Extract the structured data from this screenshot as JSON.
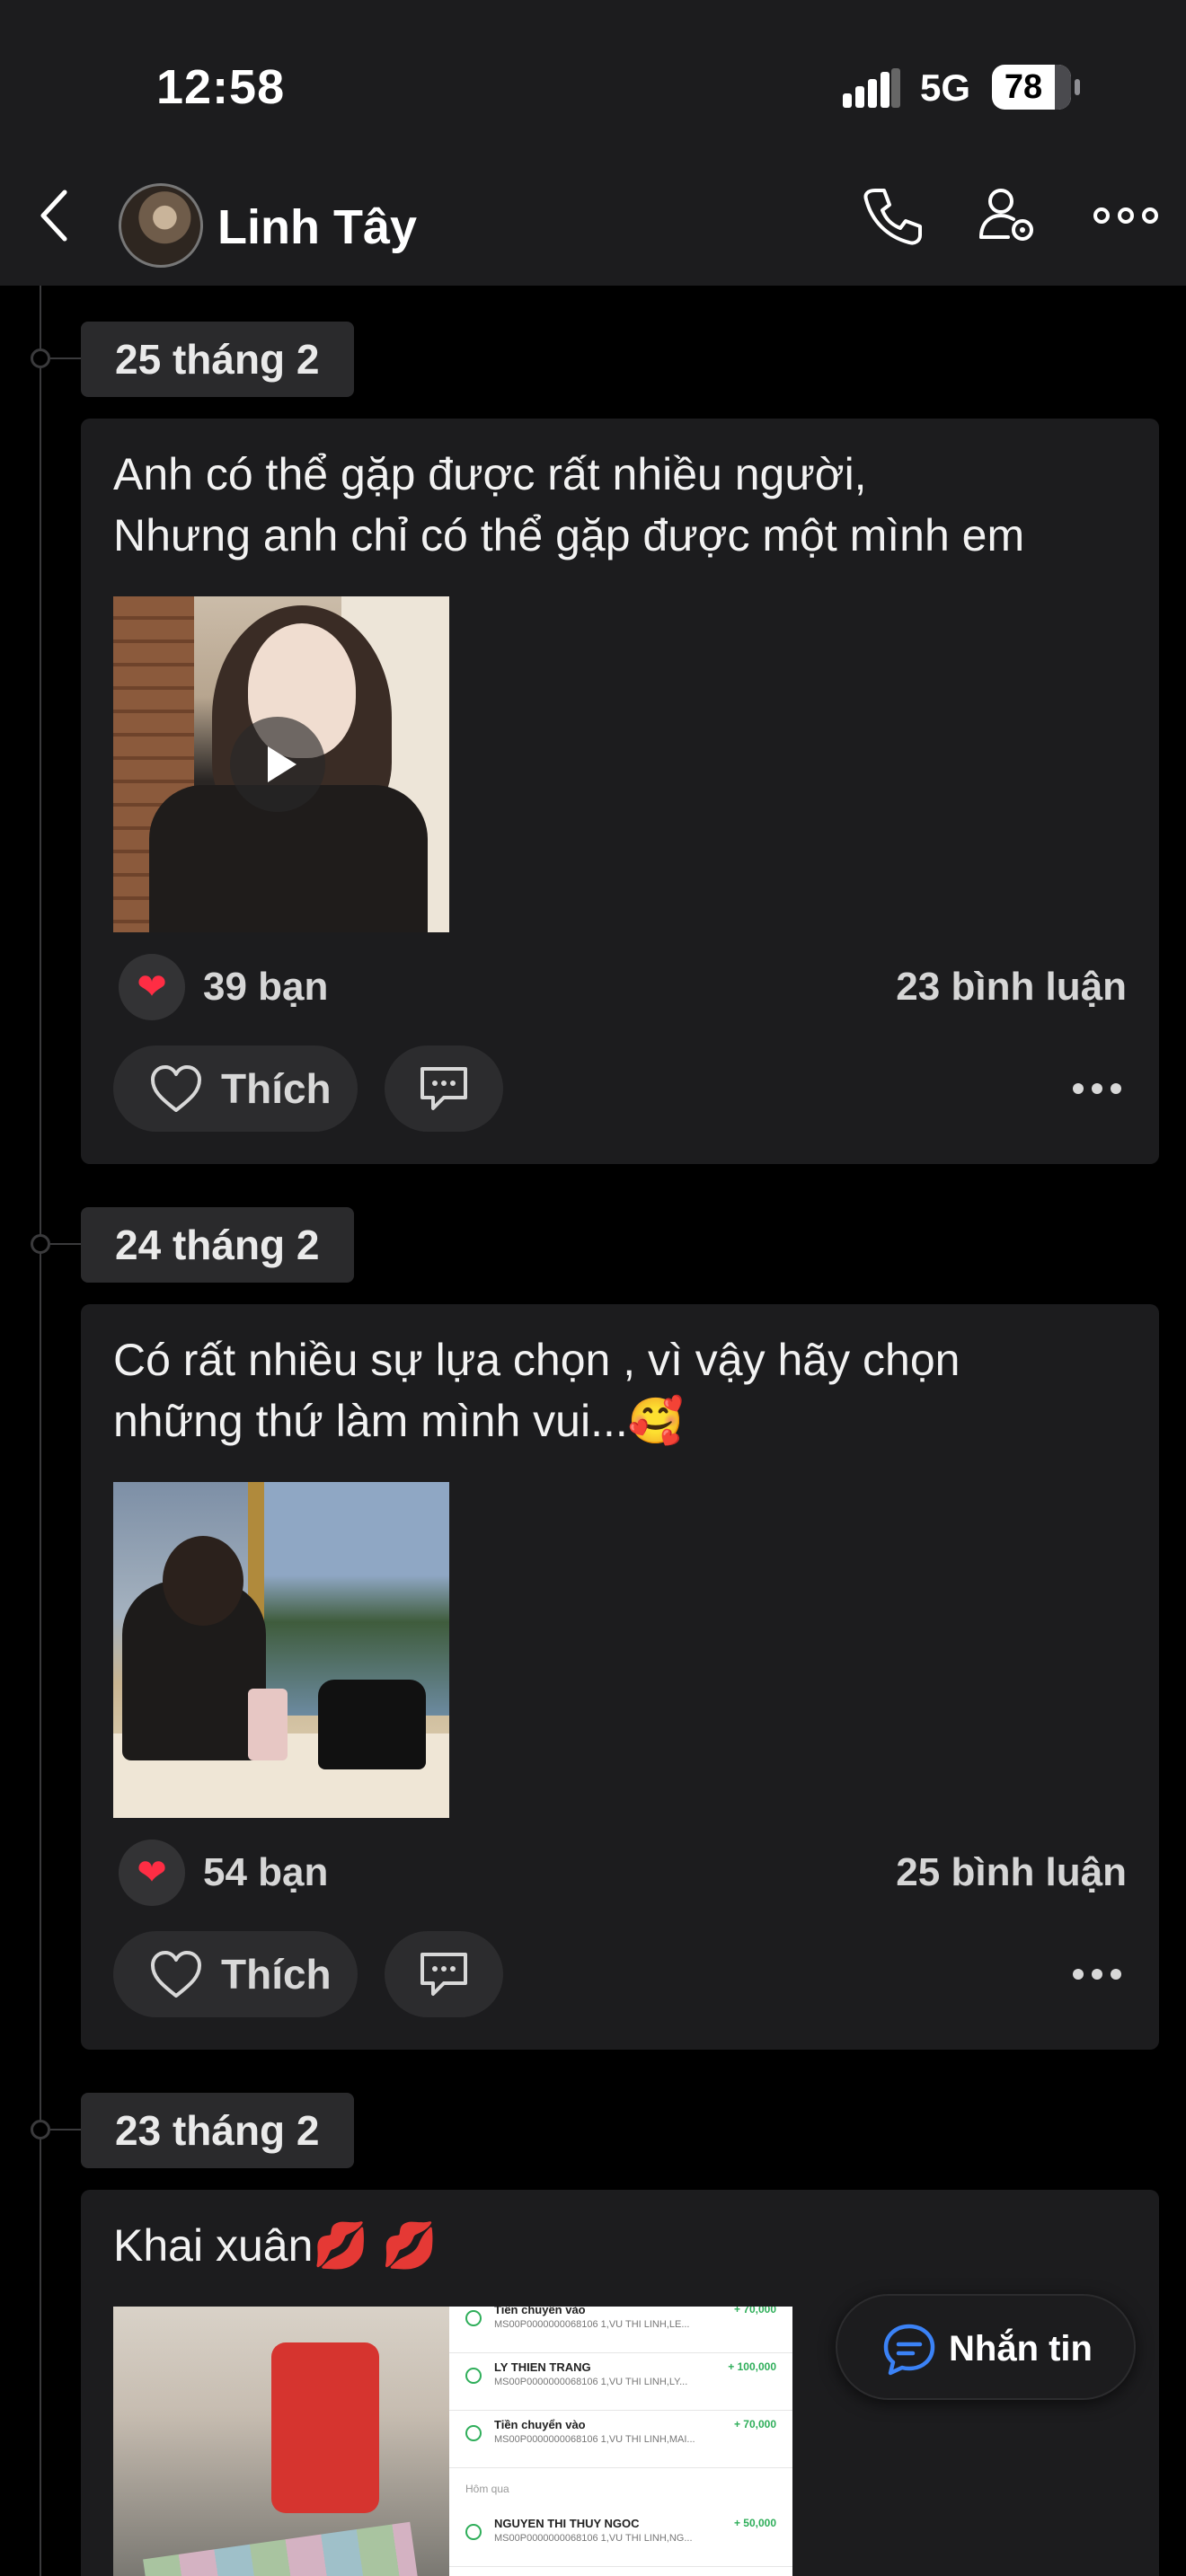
{
  "status_bar": {
    "time": "12:58",
    "network": "5G",
    "battery": "78",
    "battery_level_percent": 78
  },
  "header": {
    "profile_name": "Linh Tây",
    "icons": [
      "back-icon",
      "phone-icon",
      "profile-settings-icon",
      "more-icon"
    ]
  },
  "posts": [
    {
      "date": "25 tháng 2",
      "text": "Anh có thể gặp được rất nhiều người,\nNhưng anh chỉ có thể gặp được một mình em",
      "media": "video",
      "likes": "39 bạn",
      "comments": "23 bình luận",
      "like_label": "Thích"
    },
    {
      "date": "24 tháng 2",
      "text": "Có rất nhiều sự lựa chọn  , vì vậy hãy chọn\nnhững thứ làm mình vui...🥰",
      "media": "photo",
      "likes": "54 bạn",
      "comments": "25 bình luận",
      "like_label": "Thích"
    },
    {
      "date": "23 tháng 2",
      "text": "Khai xuân💋 💋",
      "media": "photos",
      "bank_rows": [
        {
          "name": "Tiền chuyển vào",
          "sub": "MS00P0000000068106 1,VU THI LINH,LE...",
          "amount": "+ 70,000"
        },
        {
          "name": "LY THIEN TRANG",
          "sub": "MS00P0000000068106 1,VU THI LINH,LY...",
          "amount": "+ 100,000"
        },
        {
          "name": "Tiền chuyển vào",
          "sub": "MS00P0000000068106 1,VU THI LINH,MAI...",
          "amount": "+ 70,000"
        },
        {
          "name": "NGUYEN THI THUY NGOC",
          "sub": "MS00P0000000068106 1,VU THI LINH,NG...",
          "amount": "+ 50,000"
        }
      ],
      "bank_separator": "Hôm qua"
    }
  ],
  "message_button": {
    "label": "Nhắn tin"
  },
  "colors": {
    "background": "#000000",
    "card": "#1c1c1e",
    "chip": "#2a2a2c",
    "heart": "#ff2d44",
    "accent_blue": "#3b82f6"
  }
}
